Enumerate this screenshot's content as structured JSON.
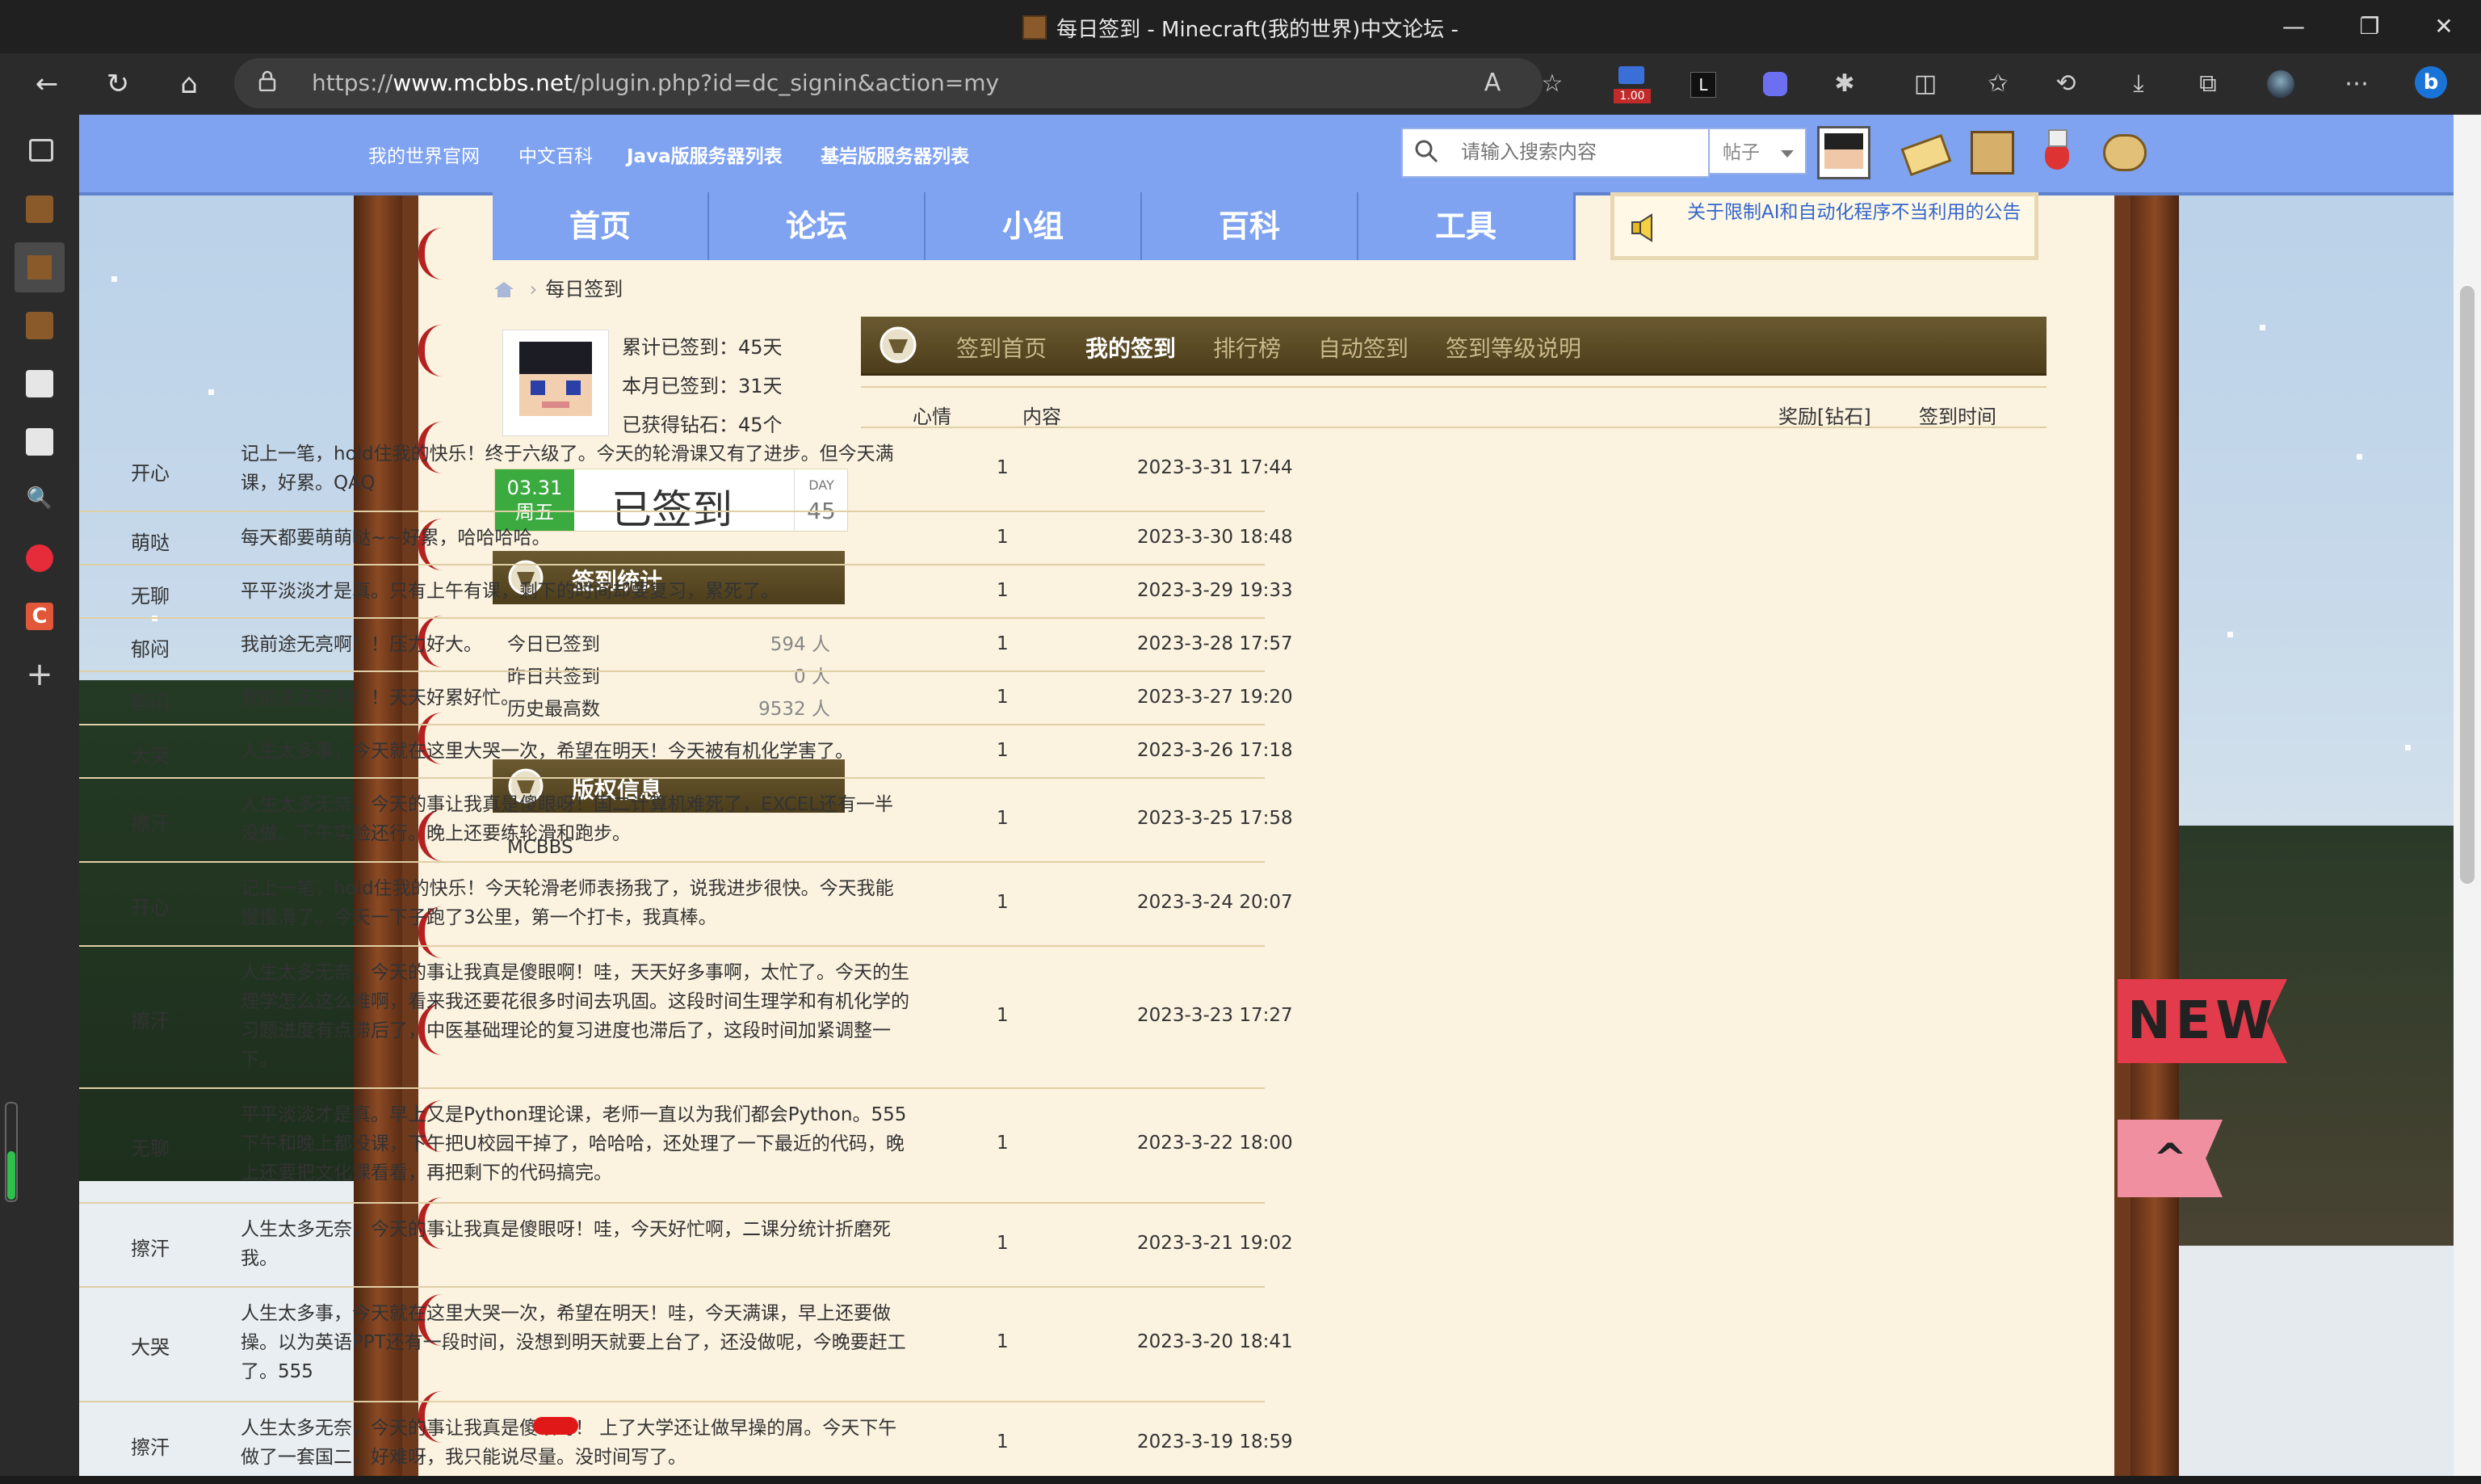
{
  "window": {
    "title": "每日签到 - Minecraft(我的世界)中文论坛 -",
    "controls": {
      "minimize": "—",
      "maximize": "❐",
      "close": "✕"
    }
  },
  "browser": {
    "url_prefix": "https://",
    "url_host": "www.mcbbs.net",
    "url_path": "/plugin.php?id=dc_signin&action=my",
    "ext_badge": "1.00"
  },
  "topbar": {
    "links": [
      "我的世界官网",
      "中文百科",
      "Java版服务器列表",
      "基岩版服务器列表"
    ],
    "search_placeholder": "请输入搜索内容",
    "search_scope": "帖子"
  },
  "nav": {
    "tabs": [
      "首页",
      "论坛",
      "小组",
      "百科",
      "工具"
    ],
    "notice": "关于限制AI和自动化程序不当利用的公告"
  },
  "breadcrumb": {
    "current": "每日签到"
  },
  "profile": {
    "total_signed": "累计已签到：45天",
    "month_signed": "本月已签到：31天",
    "diamonds": "已获得钻石：45个"
  },
  "signed_card": {
    "date": "03.31",
    "weekday": "周五",
    "label": "已签到",
    "day_label": "DAY",
    "day_value": "45"
  },
  "stats": {
    "title": "签到统计",
    "rows": [
      {
        "label": "今日已签到",
        "value": "594 人"
      },
      {
        "label": "昨日共签到",
        "value": "0 人"
      },
      {
        "label": "历史最高数",
        "value": "9532 人"
      }
    ]
  },
  "copyright": {
    "title": "版权信息",
    "text": "MCBBS"
  },
  "signin_tabs": [
    "签到首页",
    "我的签到",
    "排行榜",
    "自动签到",
    "签到等级说明"
  ],
  "table": {
    "headers": {
      "mood": "心情",
      "content": "内容",
      "reward": "奖励[钻石]",
      "time": "签到时间"
    },
    "rows": [
      {
        "mood": "开心",
        "content": "记上一笔，hold住我的快乐！终于六级了。今天的轮滑课又有了进步。但今天满课，好累。QAQ",
        "reward": "1",
        "time": "2023-3-31 17:44"
      },
      {
        "mood": "萌哒",
        "content": "每天都要萌萌哒~~好累，哈哈哈哈。",
        "reward": "1",
        "time": "2023-3-30 18:48"
      },
      {
        "mood": "无聊",
        "content": "平平淡淡才是真。只有上午有课，剩下的时间却要复习，累死了。",
        "reward": "1",
        "time": "2023-3-29 19:33"
      },
      {
        "mood": "郁闷",
        "content": "我前途无亮啊！！压力好大。",
        "reward": "1",
        "time": "2023-3-28 17:57"
      },
      {
        "mood": "郁闷",
        "content": "我前途无亮啊！！天天好累好忙。",
        "reward": "1",
        "time": "2023-3-27 19:20"
      },
      {
        "mood": "大哭",
        "content": "人生太多事，今天就在这里大哭一次，希望在明天！今天被有机化学害了。",
        "reward": "1",
        "time": "2023-3-26 17:18"
      },
      {
        "mood": "擦汗",
        "content": "人生太多无奈，今天的事让我真是傻眼呀！国二计算机难死了，EXCEL还有一半没做。下午实验还行。晚上还要练轮滑和跑步。",
        "reward": "1",
        "time": "2023-3-25 17:58"
      },
      {
        "mood": "开心",
        "content": "记上一笔，hold住我的快乐！今天轮滑老师表扬我了，说我进步很快。今天我能慢慢滑了。今天一下子跑了3公里，第一个打卡，我真棒。",
        "reward": "1",
        "time": "2023-3-24 20:07"
      },
      {
        "mood": "擦汗",
        "content": "人生太多无奈，今天的事让我真是傻眼啊！哇，天天好多事啊，太忙了。今天的生理学怎么这么难啊，看来我还要花很多时间去巩固。这段时间生理学和有机化学的习题进度有点滞后了，中医基础理论的复习进度也滞后了，这段时间加紧调整一下。",
        "reward": "1",
        "time": "2023-3-23 17:27"
      },
      {
        "mood": "无聊",
        "content": "平平淡淡才是真。早上又是Python理论课，老师一直以为我们都会Python。555下午和晚上都没课，下午把U校园干掉了，哈哈哈，还处理了一下最近的代码，晚上还要把文化课看看，再把剩下的代码搞完。",
        "reward": "1",
        "time": "2023-3-22 18:00"
      },
      {
        "mood": "擦汗",
        "content": "人生太多无奈，今天的事让我真是傻眼呀！哇，今天好忙啊，二课分统计折磨死我。",
        "reward": "1",
        "time": "2023-3-21 19:02"
      },
      {
        "mood": "大哭",
        "content": "人生太多事，今天就在这里大哭一次，希望在明天！哇，今天满课，早上还要做操。以为英语PPT还有一段时间，没想到明天就要上台了，还没做呢，今晚要赶工了。555",
        "reward": "1",
        "time": "2023-3-20 18:41"
      },
      {
        "mood": "擦汗",
        "content": "人生太多无奈，今天的事让我真是傻眼呀！       上了大学还让做早操的屑。今天下午做了一套国二，好难呀，我只能说尽量。没时间写了。",
        "reward": "1",
        "time": "2023-3-19 18:59"
      }
    ]
  },
  "decor": {
    "new_badge": "NEW",
    "top_badge": "^"
  },
  "colors": {
    "forum_blue": "#7fa3f1",
    "paper": "#fbf2e0",
    "header_brown": "#5a4a22",
    "border_red": "#b52020"
  }
}
